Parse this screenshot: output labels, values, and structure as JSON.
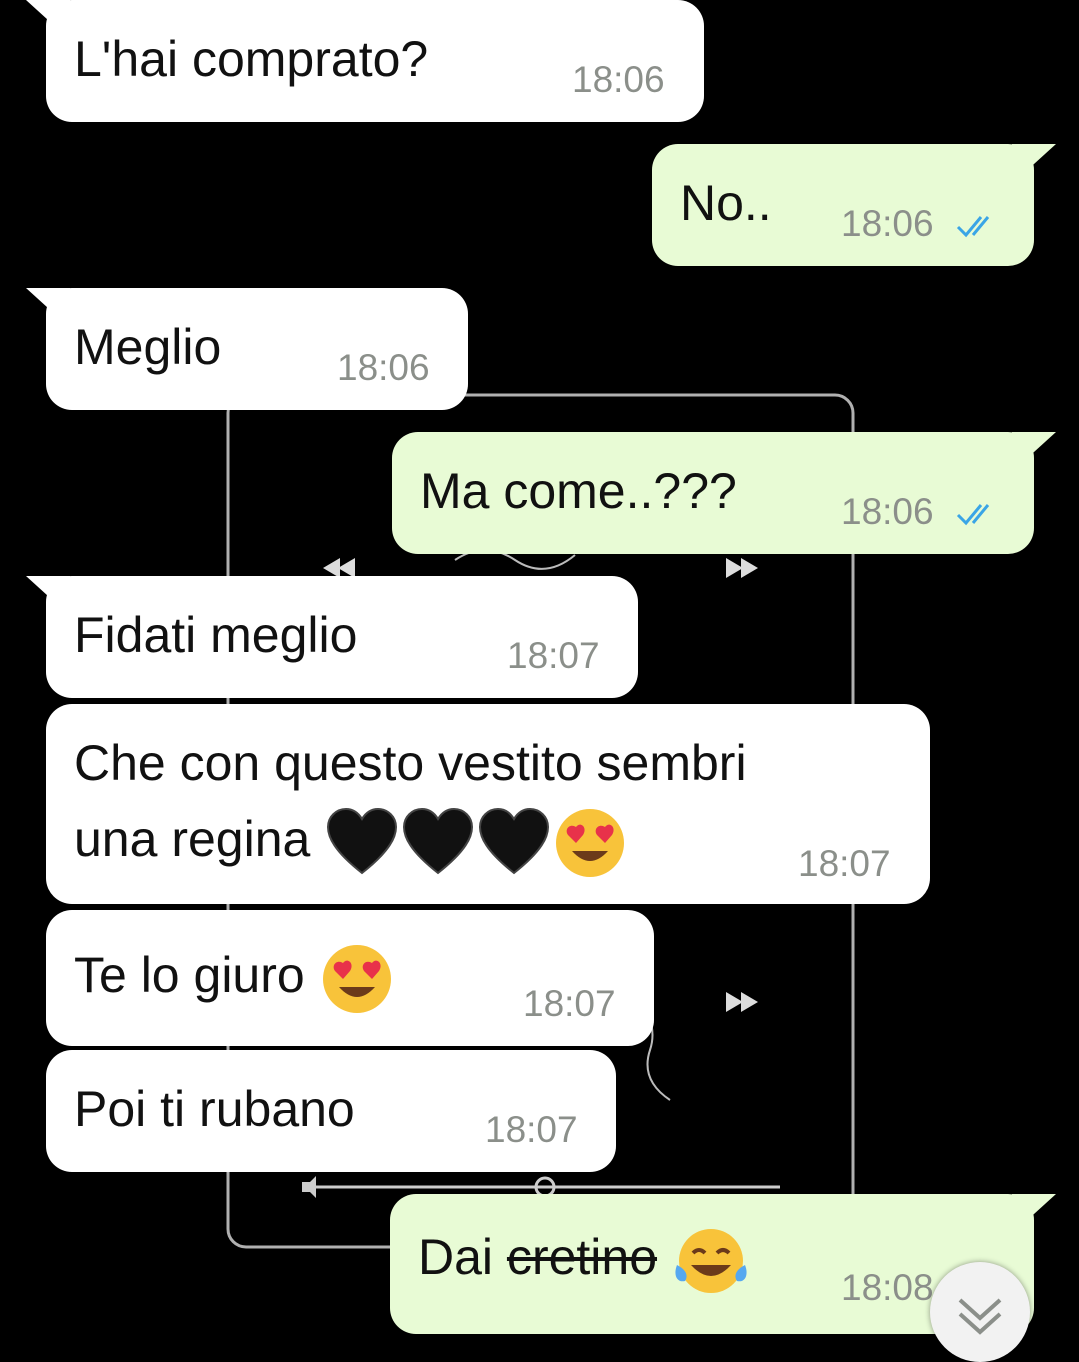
{
  "messages": [
    {
      "id": "m1",
      "dir": "in",
      "text": "L'hai comprato?",
      "time": "18:06"
    },
    {
      "id": "m2",
      "dir": "out",
      "text": "No..",
      "time": "18:06",
      "status": "read"
    },
    {
      "id": "m3",
      "dir": "in",
      "text": "Meglio",
      "time": "18:06"
    },
    {
      "id": "m4",
      "dir": "out",
      "text": "Ma come..???",
      "time": "18:06",
      "status": "read"
    },
    {
      "id": "m5",
      "dir": "in",
      "text": "Fidati meglio",
      "time": "18:07"
    },
    {
      "id": "m6",
      "dir": "in",
      "line1": "Che con questo vestito sembri",
      "line2": "una regina",
      "emojis": [
        "black-heart",
        "black-heart",
        "black-heart",
        "heart-eyes"
      ],
      "time": "18:07"
    },
    {
      "id": "m7",
      "dir": "in",
      "text": "Te lo giuro",
      "emojis": [
        "heart-eyes"
      ],
      "time": "18:07"
    },
    {
      "id": "m8",
      "dir": "in",
      "text": "Poi ti rubano",
      "time": "18:07"
    },
    {
      "id": "m9",
      "dir": "out",
      "text": "Dai",
      "strike": "cretino",
      "emojis": [
        "tears-of-joy"
      ],
      "time": "18:08",
      "status": "read"
    }
  ],
  "colors": {
    "background": "#000000",
    "incoming_bubble": "#ffffff",
    "outgoing_bubble": "#e8fbd5",
    "read_ticks": "#3aa5e6",
    "timestamp": "#8b8f8a"
  },
  "icons": [
    "double-check-icon",
    "scroll-down-chevron-icon",
    "rewind-icon",
    "fast-forward-icon",
    "volume-icon"
  ]
}
